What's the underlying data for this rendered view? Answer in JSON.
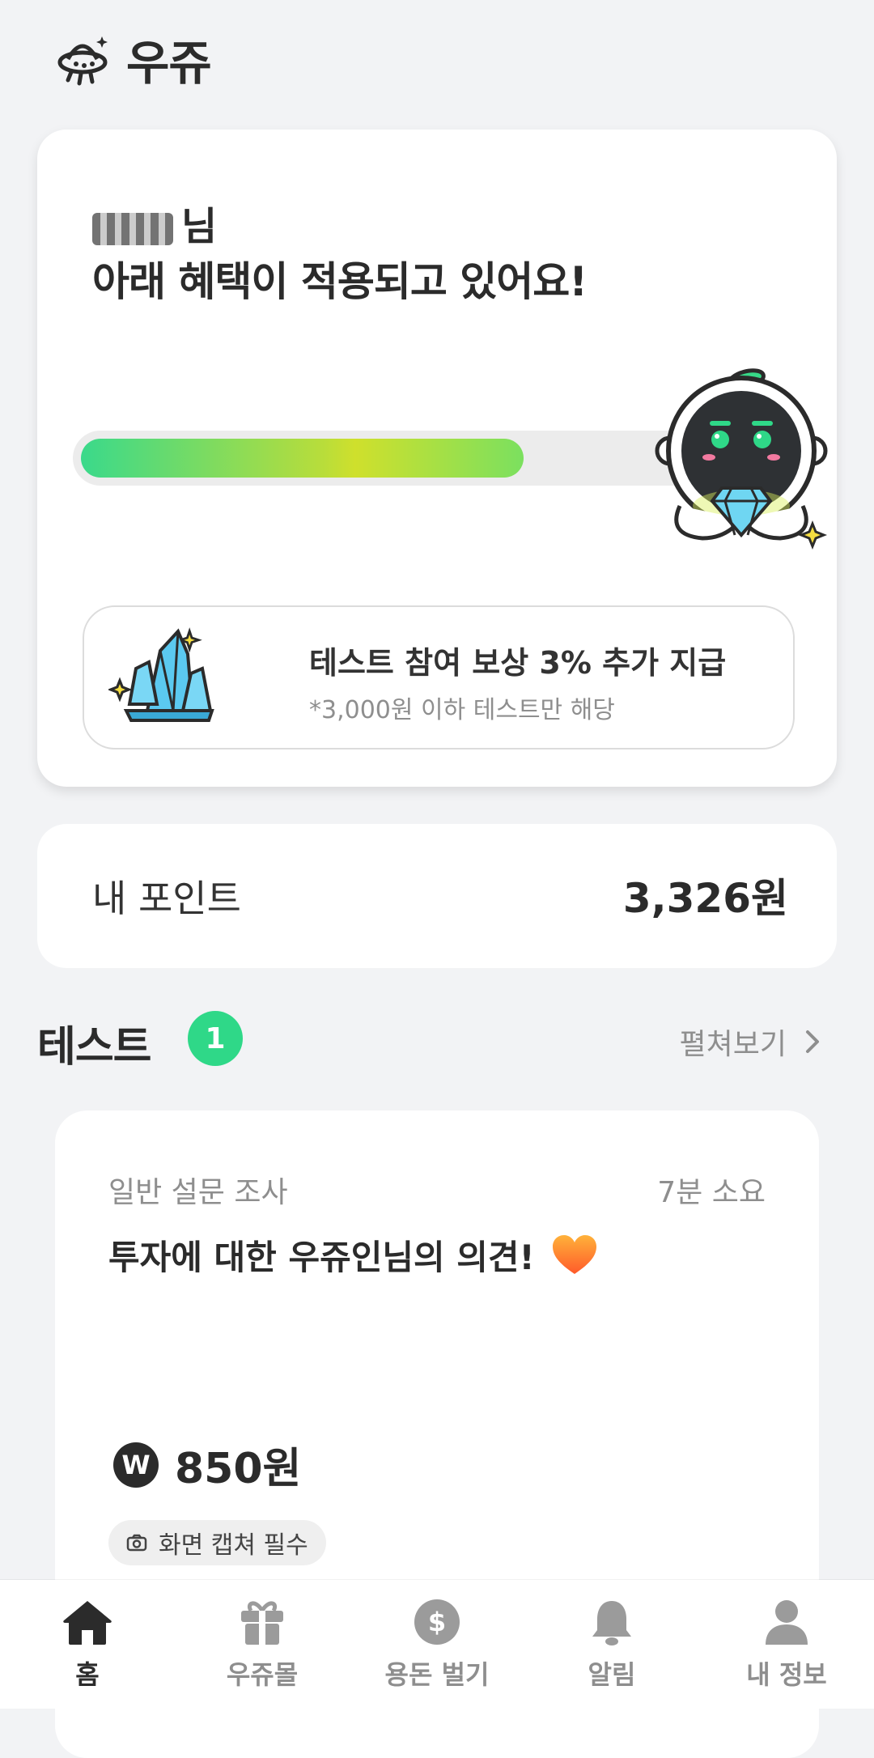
{
  "app": {
    "title": "우쥬"
  },
  "greeting": {
    "suffix": "님",
    "line": "아래 혜택이 적용되고 있어요!"
  },
  "progress": {
    "value": 0.72
  },
  "benefit": {
    "title": "테스트 참여 보상 3% 추가 지급",
    "subtitle": "*3,000원 이하 테스트만 해당"
  },
  "points": {
    "label": "내 포인트",
    "value": "3,326원"
  },
  "tests_section": {
    "title": "테스트",
    "count": "1",
    "expand_label": "펼쳐보기"
  },
  "test_card": {
    "category": "일반 설문 조사",
    "duration": "7분 소요",
    "title": "투자에 대한 우쥬인님의 의견!",
    "reward_badge": "W",
    "reward": "850원",
    "tag": "화면 캡쳐 필수"
  },
  "nav": {
    "items": [
      {
        "label": "홈",
        "icon": "home-icon",
        "active": true
      },
      {
        "label": "우쥬몰",
        "icon": "gift-icon",
        "active": false
      },
      {
        "label": "용돈 벌기",
        "icon": "dollar-icon",
        "active": false
      },
      {
        "label": "알림",
        "icon": "bell-icon",
        "active": false
      },
      {
        "label": "내 정보",
        "icon": "person-icon",
        "active": false
      }
    ]
  },
  "colors": {
    "accent": "#2fd888",
    "dark": "#2b2b2b",
    "muted": "#8e8e8e"
  }
}
